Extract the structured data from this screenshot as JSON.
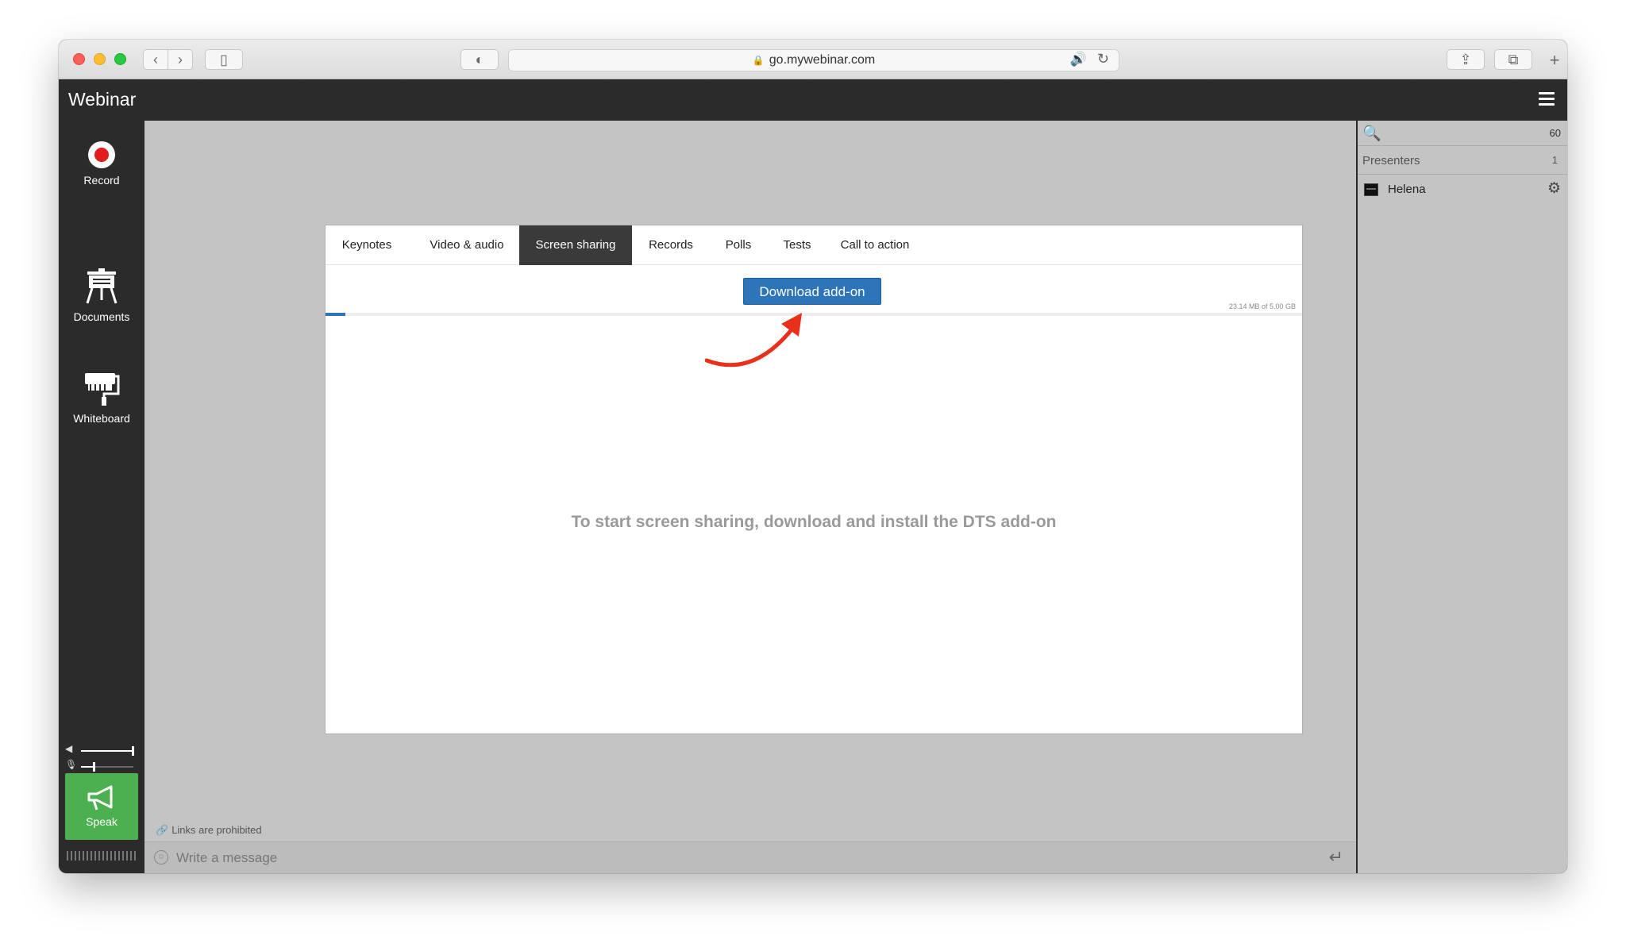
{
  "browser": {
    "url": "go.mywebinar.com",
    "lock_glyph": "🔒",
    "back_glyph": "‹",
    "forward_glyph": "›",
    "sidebar_glyph": "▯",
    "shield_glyph": "◐",
    "speaker_glyph": "🔊",
    "reload_glyph": "↻",
    "share_glyph": "⇪",
    "tabs_glyph": "⧉",
    "newtab_glyph": "+"
  },
  "app": {
    "title": "Webinar"
  },
  "left_rail": {
    "items": [
      {
        "label": "Record",
        "icon": "record-icon"
      },
      {
        "label": "Documents",
        "icon": "documents-icon"
      },
      {
        "label": "Whiteboard",
        "icon": "whiteboard-icon"
      }
    ],
    "volume": {
      "speaker_level": 0.98,
      "mic_level": 0.24,
      "speaker_glyph": "◀",
      "mic_glyph": "🎙"
    },
    "speak": {
      "label": "Speak",
      "icon_glyph": "📢"
    }
  },
  "stage": {
    "tabs": [
      {
        "label": "Keynotes",
        "active": false
      },
      {
        "label": "Video & audio",
        "active": false
      },
      {
        "label": "Screen sharing",
        "active": true
      },
      {
        "label": "Records",
        "active": false
      },
      {
        "label": "Polls",
        "active": false
      },
      {
        "label": "Tests",
        "active": false
      },
      {
        "label": "Call to action",
        "active": false
      }
    ],
    "download_button": "Download add-on",
    "storage": {
      "text": "23.14 MB of 5.00 GB",
      "used_fraction": 0.02
    },
    "empty_message": "To start screen sharing, download and install the DTS add-on"
  },
  "chat": {
    "links_note": "Links are prohibited",
    "link_glyph": "🔗",
    "placeholder": "Write a message",
    "emoji_glyph": "☺",
    "send_glyph": "↵"
  },
  "participants": {
    "search_glyph": "🔍",
    "total_count": "60",
    "section_label": "Presenters",
    "section_count": "1",
    "users": [
      {
        "name": "Helena"
      }
    ],
    "gear_glyph": "⚙"
  },
  "colors": {
    "accent_blue": "#2d74b8",
    "speak_green": "#4caf50",
    "record_red": "#e21c1c",
    "annotation_arrow": "#e8311a"
  }
}
